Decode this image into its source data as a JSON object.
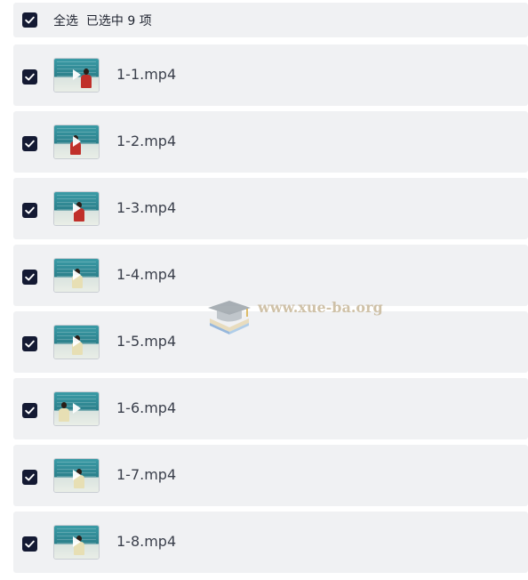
{
  "header": {
    "select_all_label": "全选",
    "selected_status": "已选中 9 项",
    "checked": true
  },
  "files": [
    {
      "name": "1-1.mp4",
      "checked": true,
      "shirt": "#c0302a"
    },
    {
      "name": "1-2.mp4",
      "checked": true,
      "shirt": "#c0302a"
    },
    {
      "name": "1-3.mp4",
      "checked": true,
      "shirt": "#c0302a"
    },
    {
      "name": "1-4.mp4",
      "checked": true,
      "shirt": "#e7dfb4"
    },
    {
      "name": "1-5.mp4",
      "checked": true,
      "shirt": "#e7dfb4"
    },
    {
      "name": "1-6.mp4",
      "checked": true,
      "shirt": "#e7dfb4"
    },
    {
      "name": "1-7.mp4",
      "checked": true,
      "shirt": "#e7dfb4"
    },
    {
      "name": "1-8.mp4",
      "checked": true,
      "shirt": "#e7dfb4"
    }
  ],
  "watermark": {
    "text": "www.xue-ba.org"
  },
  "colors": {
    "row_bg": "#f0f1f3",
    "checkbox": "#141a33",
    "text": "#3a3f4b"
  }
}
